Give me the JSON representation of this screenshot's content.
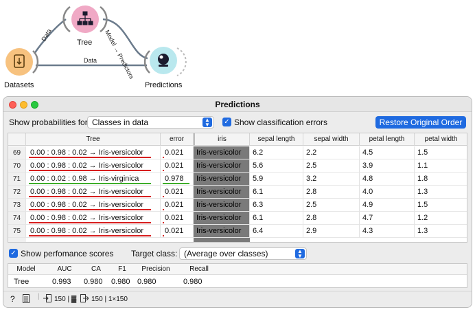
{
  "workflow": {
    "nodes": [
      {
        "label": "Datasets"
      },
      {
        "label": "Tree"
      },
      {
        "label": "Predictions"
      }
    ],
    "links": [
      {
        "label": "Data"
      },
      {
        "label": "Model → Predictors"
      },
      {
        "label": "Data"
      }
    ]
  },
  "window": {
    "title": "Predictions",
    "show_probabilities_label": "Show probabilities for",
    "probabilities_value": "Classes in data",
    "show_errors_label": "Show classification errors",
    "restore_button": "Restore Original Order"
  },
  "table": {
    "headers": [
      "",
      "Tree",
      "error",
      "iris",
      "sepal length",
      "sepal width",
      "petal length",
      "petal width"
    ],
    "rows": [
      {
        "idx": "69",
        "tree": "0.00 : 0.98 : 0.02 → Iris-versicolor",
        "error": "0.021",
        "iris": "Iris-versicolor",
        "sl": "6.2",
        "sw": "2.2",
        "pl": "4.5",
        "pw": "1.5",
        "color": "#d71f1f"
      },
      {
        "idx": "70",
        "tree": "0.00 : 0.98 : 0.02 → Iris-versicolor",
        "error": "0.021",
        "iris": "Iris-versicolor",
        "sl": "5.6",
        "sw": "2.5",
        "pl": "3.9",
        "pw": "1.1",
        "color": "#d71f1f"
      },
      {
        "idx": "71",
        "tree": "0.00 : 0.02 : 0.98 → Iris-virginica",
        "error": "0.978",
        "iris": "Iris-versicolor",
        "sl": "5.9",
        "sw": "3.2",
        "pl": "4.8",
        "pw": "1.8",
        "color": "#3fae2a"
      },
      {
        "idx": "72",
        "tree": "0.00 : 0.98 : 0.02 → Iris-versicolor",
        "error": "0.021",
        "iris": "Iris-versicolor",
        "sl": "6.1",
        "sw": "2.8",
        "pl": "4.0",
        "pw": "1.3",
        "color": "#d71f1f"
      },
      {
        "idx": "73",
        "tree": "0.00 : 0.98 : 0.02 → Iris-versicolor",
        "error": "0.021",
        "iris": "Iris-versicolor",
        "sl": "6.3",
        "sw": "2.5",
        "pl": "4.9",
        "pw": "1.5",
        "color": "#d71f1f"
      },
      {
        "idx": "74",
        "tree": "0.00 : 0.98 : 0.02 → Iris-versicolor",
        "error": "0.021",
        "iris": "Iris-versicolor",
        "sl": "6.1",
        "sw": "2.8",
        "pl": "4.7",
        "pw": "1.2",
        "color": "#d71f1f"
      },
      {
        "idx": "75",
        "tree": "0.00 : 0.98 : 0.02 → Iris-versicolor",
        "error": "0.021",
        "iris": "Iris-versicolor",
        "sl": "6.4",
        "sw": "2.9",
        "pl": "4.3",
        "pw": "1.3",
        "color": "#d71f1f"
      }
    ]
  },
  "scores": {
    "show_label": "Show perfomance scores",
    "target_label": "Target class:",
    "target_value": "(Average over classes)",
    "headers": [
      "Model",
      "AUC",
      "CA",
      "F1",
      "Precision",
      "Recall"
    ],
    "row": [
      "Tree",
      "0.993",
      "0.980",
      "0.980",
      "0.980",
      "0.980"
    ]
  },
  "status": {
    "input_count": "150 | ▓",
    "output_count": "150 | 1×150"
  },
  "colors": {
    "accent": "#1f6ae0",
    "error_red": "#d71f1f",
    "error_green": "#3fae2a",
    "iris_fill": "#7a7a7a"
  }
}
